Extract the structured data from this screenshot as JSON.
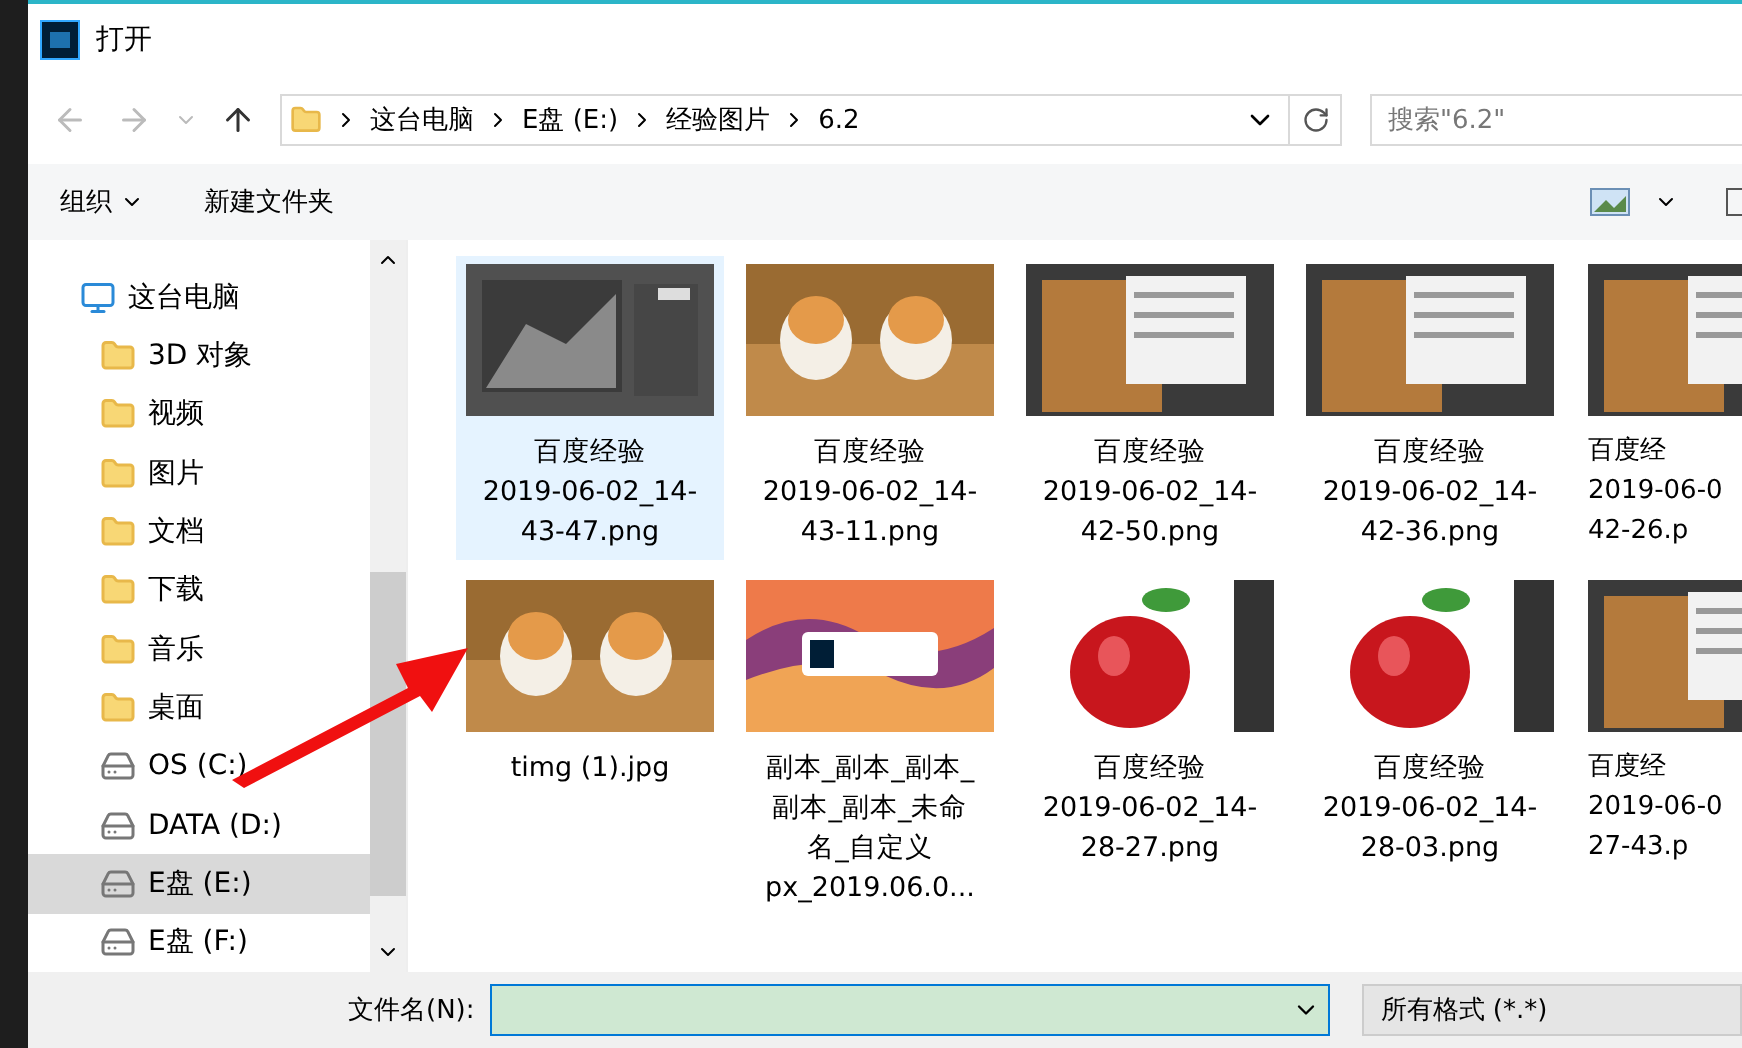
{
  "window": {
    "title": "打开"
  },
  "address": {
    "crumbs": [
      "这台电脑",
      "E盘 (E:)",
      "经验图片",
      "6.2"
    ]
  },
  "search": {
    "placeholder": "搜索\"6.2\""
  },
  "toolbar": {
    "organize": "组织",
    "new_folder": "新建文件夹"
  },
  "sidebar": {
    "items": [
      {
        "kind": "pc",
        "label": "这台电脑",
        "selected": false
      },
      {
        "kind": "folder",
        "label": "3D 对象",
        "selected": false
      },
      {
        "kind": "folder",
        "label": "视频",
        "selected": false
      },
      {
        "kind": "folder",
        "label": "图片",
        "selected": false
      },
      {
        "kind": "folder",
        "label": "文档",
        "selected": false
      },
      {
        "kind": "folder",
        "label": "下载",
        "selected": false
      },
      {
        "kind": "folder",
        "label": "音乐",
        "selected": false
      },
      {
        "kind": "folder",
        "label": "桌面",
        "selected": false
      },
      {
        "kind": "drive",
        "label": "OS (C:)",
        "selected": false
      },
      {
        "kind": "drive",
        "label": "DATA (D:)",
        "selected": false
      },
      {
        "kind": "drive",
        "label": "E盘 (E:)",
        "selected": true
      },
      {
        "kind": "drive",
        "label": "E盘 (F:)",
        "selected": false
      }
    ]
  },
  "files": [
    {
      "lines": [
        "百度经验",
        "2019-06-02_14-",
        "43-47.png"
      ],
      "selected": true
    },
    {
      "lines": [
        "百度经验",
        "2019-06-02_14-",
        "43-11.png"
      ],
      "selected": false
    },
    {
      "lines": [
        "百度经验",
        "2019-06-02_14-",
        "42-50.png"
      ],
      "selected": false
    },
    {
      "lines": [
        "百度经验",
        "2019-06-02_14-",
        "42-36.png"
      ],
      "selected": false
    },
    {
      "lines": [
        "百度经",
        "2019-06-0",
        "42-26.p"
      ],
      "selected": false
    },
    {
      "lines": [
        "timg (1).jpg"
      ],
      "selected": false
    },
    {
      "lines": [
        "副本_副本_副本_",
        "副本_副本_未命",
        "名_自定义",
        "px_2019.06.0..."
      ],
      "selected": false
    },
    {
      "lines": [
        "百度经验",
        "2019-06-02_14-",
        "28-27.png"
      ],
      "selected": false
    },
    {
      "lines": [
        "百度经验",
        "2019-06-02_14-",
        "28-03.png"
      ],
      "selected": false
    },
    {
      "lines": [
        "百度经",
        "2019-06-0",
        "27-43.p"
      ],
      "selected": false
    }
  ],
  "bottom": {
    "filename_label": "文件名(N):",
    "filter": "所有格式 (*.*)"
  }
}
